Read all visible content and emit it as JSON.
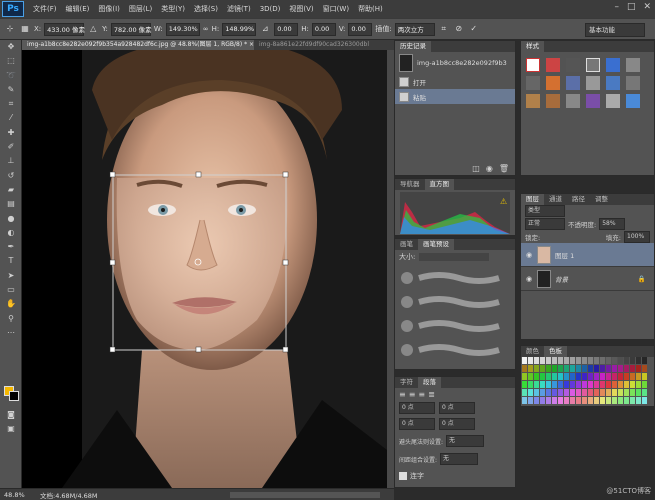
{
  "menubar": {
    "logo": "Ps",
    "items": [
      "文件(F)",
      "编辑(E)",
      "图像(I)",
      "图层(L)",
      "类型(Y)",
      "选择(S)",
      "滤镜(T)",
      "3D(D)",
      "视图(V)",
      "窗口(W)",
      "帮助(H)"
    ],
    "min": "–",
    "max": "□",
    "close": "✕"
  },
  "options": {
    "x_label": "X:",
    "x_value": "433.00 像素",
    "y_label": "Y:",
    "y_value": "782.00 像素",
    "w_label": "W:",
    "w_value": "149.30%",
    "link": "∞",
    "h_label": "H:",
    "h_value": "148.99%",
    "angle_value": "0.00",
    "hskew_label": "H:",
    "hskew_value": "0.00",
    "vskew_label": "V:",
    "vskew_value": "0.00",
    "interp_label": "插值:",
    "interp_value": "两次立方",
    "workspace": "基本功能"
  },
  "doc_tabs": [
    "img-a1b8cc8e282e092f9b354a928482df6c.jpg @ 48.8%(图层 1, RGB/8) * ×",
    "img-8a861e22fd9df90cad326300dbl"
  ],
  "status": {
    "zoom": "48.8%",
    "doc": "文档:4.68M/4.68M"
  },
  "history": {
    "tabs": [
      "历史记录"
    ],
    "snapshot": "img-a1b8cc8e282e092f9b354...",
    "items": [
      "打开",
      "粘贴"
    ]
  },
  "styles": {
    "tabs": [
      "样式"
    ]
  },
  "histogram": {
    "tabs": [
      "导航器",
      "直方图"
    ]
  },
  "brush": {
    "tabs": [
      "画笔",
      "画笔预设"
    ],
    "size_label": "大小:"
  },
  "layers": {
    "tabs": [
      "图层",
      "通道",
      "路径",
      "调整"
    ],
    "kind": "类型",
    "blend": "正常",
    "opacity_label": "不透明度:",
    "opacity": "58%",
    "lock_label": "锁定:",
    "fill_label": "填充:",
    "fill": "100%",
    "items": [
      {
        "name": "图层 1"
      },
      {
        "name": "背景"
      }
    ]
  },
  "swatch_panel": {
    "tabs": [
      "颜色",
      "色板"
    ]
  },
  "character": {
    "tabs": [
      "字符",
      "段落"
    ],
    "fields": [
      "0 点",
      "0 点",
      "0 点",
      "0 点"
    ],
    "hyphen_label": "避头尾法则设置:",
    "hyphen_value": "无",
    "spacing_label": "间距组合设置:",
    "spacing_value": "无",
    "hyphenate": "连字"
  },
  "watermark": "@51CTO博客",
  "colors": {
    "accent": "#6a7a93",
    "fg": "#f5b800",
    "bg": "#000000"
  }
}
